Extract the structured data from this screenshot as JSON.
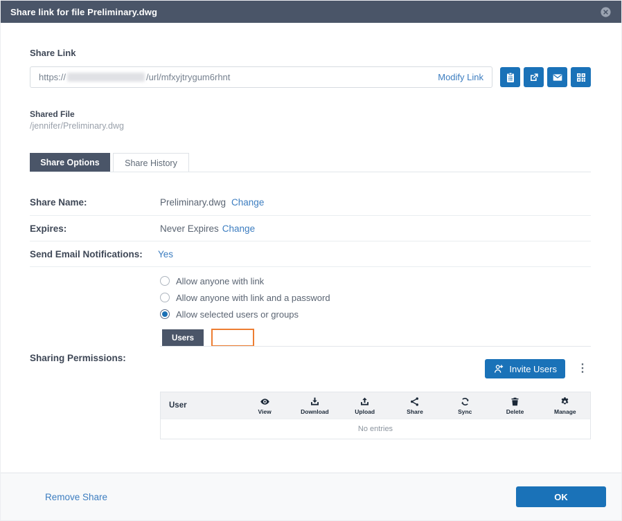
{
  "header": {
    "title": "Share link for file Preliminary.dwg",
    "close_icon": "circle-x-icon"
  },
  "share_link": {
    "label": "Share Link",
    "url_prefix": "https://",
    "url_suffix": "/url/mfxyjtrygum6rhnt",
    "modify_link_label": "Modify Link",
    "action_icons": [
      "clipboard-icon",
      "external-link-icon",
      "envelope-icon",
      "qr-code-icon"
    ]
  },
  "shared_file": {
    "label": "Shared File",
    "path": "/jennifer/Preliminary.dwg"
  },
  "tabs": {
    "share_options": "Share Options",
    "share_history": "Share History",
    "active_tab": "Share Options"
  },
  "details": {
    "rows": [
      {
        "label": "Share Name:",
        "value": "Preliminary.dwg",
        "action": "Change"
      },
      {
        "label": "Expires:",
        "value": "Never Expires",
        "action": "Change"
      },
      {
        "label": "Send Email Notifications:",
        "value": "Yes",
        "action": ""
      }
    ]
  },
  "access": {
    "options": [
      {
        "label": "Allow anyone with link",
        "selected": false
      },
      {
        "label": "Allow anyone with link and a password",
        "selected": false
      },
      {
        "label": "Allow selected users or groups",
        "selected": true
      }
    ]
  },
  "selector_tabs": {
    "users_label": "Users",
    "highlighted_tab_label": ""
  },
  "permissions": {
    "label": "Sharing Permissions:",
    "invite_users_label": "Invite Users",
    "invite_icon": "user-plus-icon",
    "more_icon": "kebab-vertical-icon",
    "table": {
      "user_column": "User",
      "permission_columns": [
        "View",
        "Download",
        "Upload",
        "Share",
        "Sync",
        "Delete",
        "Manage"
      ],
      "column_icons": [
        "eye-icon",
        "download-icon",
        "upload-icon",
        "share-icon",
        "sync-icon",
        "trash-icon",
        "gear-icon"
      ],
      "empty_text": "No entries"
    }
  },
  "footer": {
    "remove_share_label": "Remove Share",
    "ok_label": "OK"
  },
  "colors": {
    "header_bg": "#4a5568",
    "primary_blue": "#1a72b8",
    "link_blue": "#3c7dc0",
    "tab_active_bg": "#4a5568",
    "highlight_orange": "#ed7d31",
    "table_header_bg": "#f1f2f4",
    "footer_bg": "#f8f9fa",
    "border": "#e2e6ea",
    "label_text": "#3e4756",
    "value_text": "#5a6472"
  }
}
